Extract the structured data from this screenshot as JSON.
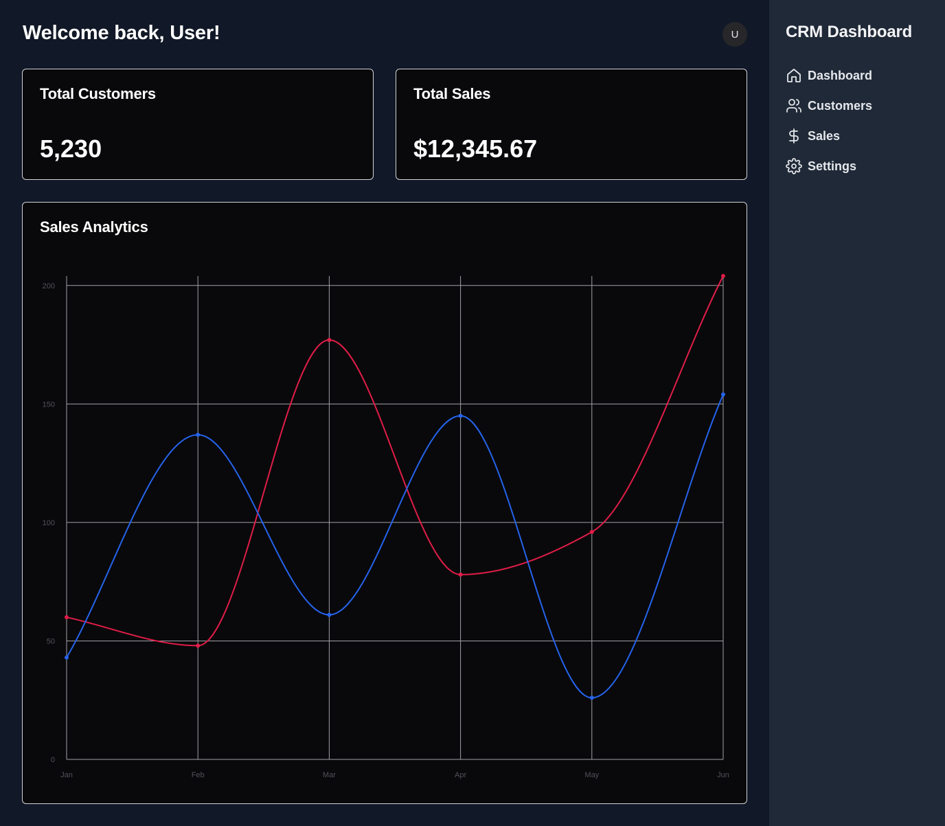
{
  "header": {
    "welcome": "Welcome back, User!",
    "avatar_initial": "U"
  },
  "stats": {
    "customers": {
      "title": "Total Customers",
      "value": "5,230"
    },
    "sales": {
      "title": "Total Sales",
      "value": "$12,345.67"
    }
  },
  "chart": {
    "title": "Sales Analytics"
  },
  "sidebar": {
    "title": "CRM Dashboard",
    "items": [
      {
        "label": "Dashboard",
        "icon": "home-icon"
      },
      {
        "label": "Customers",
        "icon": "users-icon"
      },
      {
        "label": "Sales",
        "icon": "dollar-icon"
      },
      {
        "label": "Settings",
        "icon": "gear-icon"
      }
    ]
  },
  "colors": {
    "series_red": "#e11d48",
    "series_blue": "#2563eb",
    "grid": "#a1a1aa"
  },
  "chart_data": {
    "type": "line",
    "categories": [
      "Jan",
      "Feb",
      "Mar",
      "Apr",
      "May",
      "Jun"
    ],
    "series": [
      {
        "values": [
          60,
          48,
          177,
          78,
          96,
          204
        ],
        "color": "#e11d48"
      },
      {
        "values": [
          43,
          137,
          61,
          145,
          26,
          154
        ],
        "color": "#2563eb"
      }
    ],
    "yticks": [
      0,
      50,
      100,
      150,
      200
    ],
    "ylim": [
      0,
      204
    ],
    "grid": true,
    "curve": "smooth"
  }
}
